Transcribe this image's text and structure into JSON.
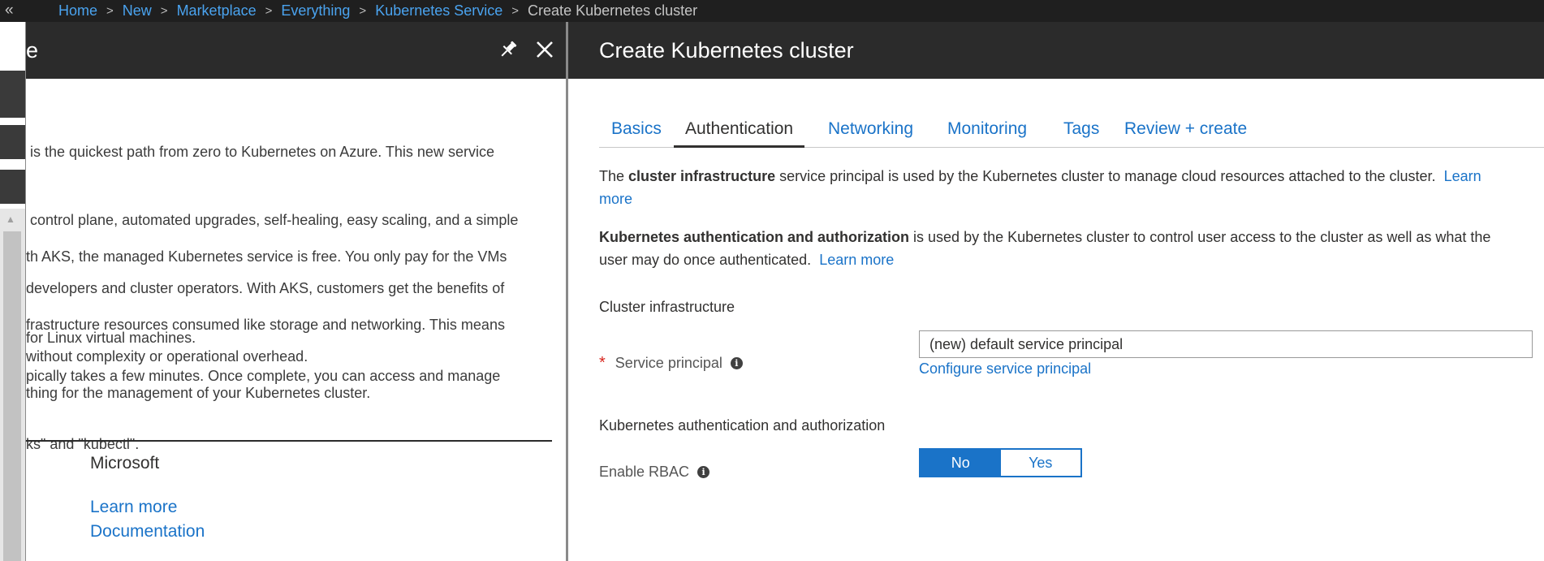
{
  "breadcrumb": {
    "items": [
      "Home",
      "New",
      "Marketplace",
      "Everything",
      "Kubernetes Service"
    ],
    "current": "Create Kubernetes cluster"
  },
  "left_blade": {
    "title": "e",
    "paragraphs": [
      [
        " is the quickest path from zero to Kubernetes on Azure. This new service",
        " control plane, automated upgrades, self-healing, easy scaling, and a simple",
        "developers and cluster operators. With AKS, customers get the benefits of",
        "without complexity or operational overhead."
      ],
      [
        "th AKS, the managed Kubernetes service is free. You only pay for the VMs",
        "frastructure resources consumed like storage and networking. This means",
        "thing for the management of your Kubernetes cluster."
      ],
      [
        "for Linux virtual machines."
      ],
      [
        "pically takes a few minutes. Once complete, you can access and manage",
        "ks\" and \"kubectl\"."
      ]
    ],
    "publisher": "Microsoft",
    "links": [
      "Learn more",
      "Documentation"
    ]
  },
  "right_blade": {
    "title": "Create Kubernetes cluster",
    "tabs": [
      "Basics",
      "Authentication",
      "Networking",
      "Monitoring",
      "Tags",
      "Review + create"
    ],
    "active_tab": "Authentication",
    "intro1": {
      "pre": "The ",
      "bold": "cluster infrastructure",
      "post": " service principal is used by the Kubernetes cluster to manage cloud resources attached to the cluster.",
      "link_a": "Learn",
      "link_b": "more"
    },
    "intro2": {
      "bold": "Kubernetes authentication and authorization",
      "post_a": " is used by the Kubernetes cluster to control user access to the cluster as well as what the",
      "post_b": "user may do once authenticated.",
      "link": "Learn more"
    },
    "section_infra": "Cluster infrastructure",
    "service_principal": {
      "label": "Service principal",
      "required_mark": "*",
      "value": "(new) default service principal",
      "configure_link": "Configure service principal"
    },
    "section_auth": "Kubernetes authentication and authorization",
    "rbac": {
      "label": "Enable RBAC",
      "options": [
        "No",
        "Yes"
      ],
      "selected": "No"
    }
  },
  "colors": {
    "accent": "#1a73c8",
    "header_bg": "#2b2b2b",
    "topbar_bg": "#1f1f1f",
    "required": "#d8241c"
  }
}
